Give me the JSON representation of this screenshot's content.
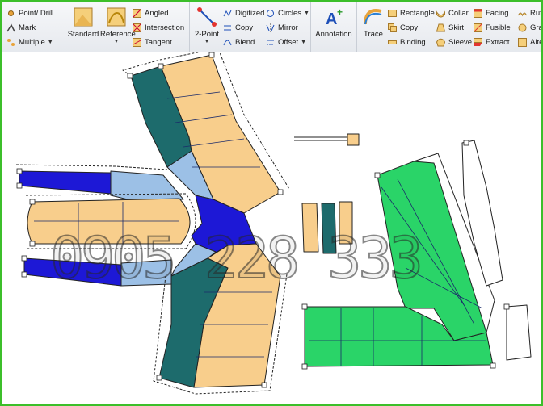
{
  "ribbon": {
    "point_drill": "Point/ Drill",
    "mark": "Mark",
    "multiple": "Multiple",
    "standard": "Standard",
    "reference": "Reference",
    "angled": "Angled",
    "intersection": "Intersection",
    "tangent": "Tangent",
    "two_point": "2-Point",
    "digitized": "Digitized",
    "copy1": "Copy",
    "blend": "Blend",
    "circles": "Circles",
    "mirror": "Mirror",
    "offset": "Offset",
    "annotation": "Annotation",
    "trace": "Trace",
    "rectangle": "Rectangle",
    "copy2": "Copy",
    "binding": "Binding",
    "collar": "Collar",
    "skirt": "Skirt",
    "sleeve": "Sleeve",
    "facing": "Facing",
    "fusible": "Fusible",
    "extract": "Extract",
    "ruffle_partial": "Ruf",
    "gra_partial": "Gra",
    "alte_partial": "Alte"
  },
  "watermark": "0905 228 333",
  "colors": {
    "tan": "#f8ce8c",
    "teal": "#1d6b6c",
    "blue": "#1d18d6",
    "light_blue": "#9cc0e6",
    "green": "#2ad468",
    "frame": "#3cbf2a"
  }
}
